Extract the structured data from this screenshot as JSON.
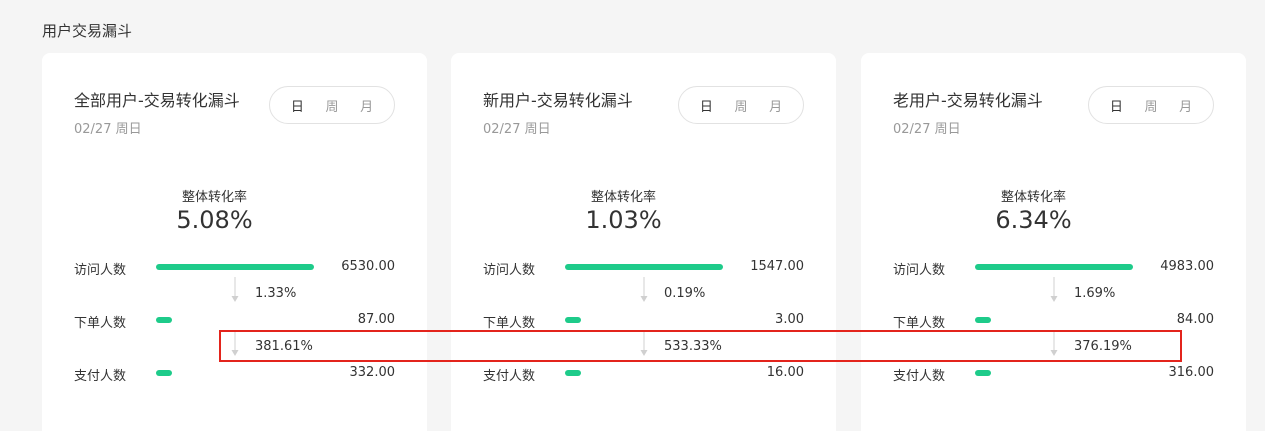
{
  "section": {
    "title": "用户交易漏斗"
  },
  "toggle_options": [
    "日",
    "周",
    "月"
  ],
  "active_toggle": 0,
  "colors": {
    "bar": "#1ecb8a",
    "highlight": "#e3241c"
  },
  "cards": [
    {
      "title": "全部用户-交易转化漏斗",
      "date": "02/27 周日",
      "overall_label": "整体转化率",
      "overall_value": "5.08%",
      "rows": [
        {
          "label": "访问人数",
          "value": "6530.00",
          "fraction": 1.0
        },
        {
          "label": "下单人数",
          "value": "87.00",
          "fraction": 0.0133
        },
        {
          "label": "支付人数",
          "value": "332.00",
          "fraction": 0.0508
        }
      ],
      "rates": [
        "1.33%",
        "381.61%"
      ]
    },
    {
      "title": "新用户-交易转化漏斗",
      "date": "02/27 周日",
      "overall_label": "整体转化率",
      "overall_value": "1.03%",
      "rows": [
        {
          "label": "访问人数",
          "value": "1547.00",
          "fraction": 1.0
        },
        {
          "label": "下单人数",
          "value": "3.00",
          "fraction": 0.0019
        },
        {
          "label": "支付人数",
          "value": "16.00",
          "fraction": 0.0103
        }
      ],
      "rates": [
        "0.19%",
        "533.33%"
      ]
    },
    {
      "title": "老用户-交易转化漏斗",
      "date": "02/27 周日",
      "overall_label": "整体转化率",
      "overall_value": "6.34%",
      "rows": [
        {
          "label": "访问人数",
          "value": "4983.00",
          "fraction": 1.0
        },
        {
          "label": "下单人数",
          "value": "84.00",
          "fraction": 0.0169
        },
        {
          "label": "支付人数",
          "value": "316.00",
          "fraction": 0.0634
        }
      ],
      "rates": [
        "1.69%",
        "376.19%"
      ]
    }
  ]
}
